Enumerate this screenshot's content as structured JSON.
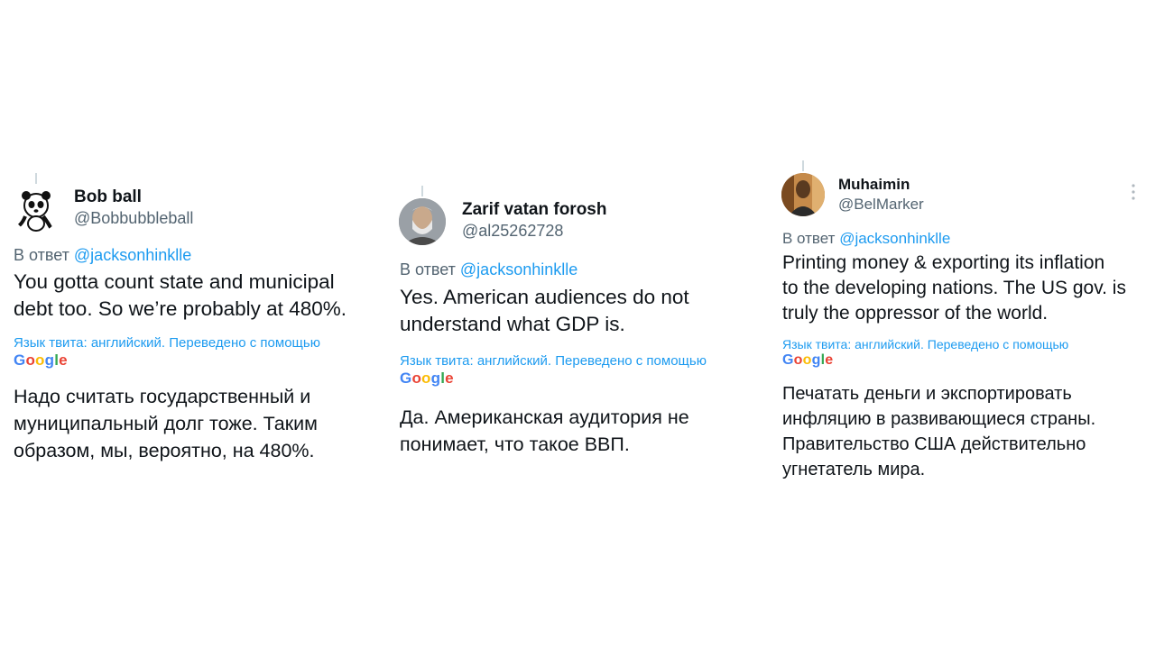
{
  "tweets": [
    {
      "name": "Bob ball",
      "handle": "@Bobbubbleball",
      "reply_prefix": "В ответ",
      "reply_mention": "@jacksonhinklle",
      "text_lines": [
        "You gotta count state and municipal",
        "debt too. So we’re probably at 480%."
      ],
      "translate_note": "Язык твита: английский. Переведено с помощью",
      "google_letters": [
        "G",
        "o",
        "o",
        "g",
        "l",
        "e"
      ],
      "translated_lines": [
        "Надо считать государственный и",
        "муниципальный долг тоже. Таким",
        "образом, мы, вероятно, на 480%."
      ]
    },
    {
      "name": "Zarif vatan forosh",
      "handle": "@al25262728",
      "reply_prefix": "В ответ",
      "reply_mention": "@jacksonhinklle",
      "text_lines": [
        "Yes. American audiences do not",
        "understand what GDP is."
      ],
      "translate_note": "Язык твита: английский. Переведено с помощью",
      "google_letters": [
        "G",
        "o",
        "o",
        "g",
        "l",
        "e"
      ],
      "translated_lines": [
        "Да. Американская аудитория не",
        "понимает, что такое ВВП."
      ]
    },
    {
      "name": "Muhaimin",
      "handle": "@BelMarker",
      "reply_prefix": "В ответ",
      "reply_mention": "@jacksonhinklle",
      "text_lines": [
        "Printing money & exporting its inflation",
        "to the developing nations. The US gov. is",
        "truly the oppressor of the world."
      ],
      "translate_note": "Язык твита: английский. Переведено с помощью",
      "google_letters": [
        "G",
        "o",
        "o",
        "g",
        "l",
        "e"
      ],
      "translated_lines": [
        "Печатать деньги и экспортировать",
        "инфляцию в развивающиеся страны.",
        "Правительство США действительно",
        "угнетатель мира."
      ]
    }
  ],
  "icons": {
    "more": "more-vertical-icon"
  },
  "colors": {
    "link": "#1d9bf0",
    "secondary": "#536471",
    "text": "#0f1419"
  }
}
